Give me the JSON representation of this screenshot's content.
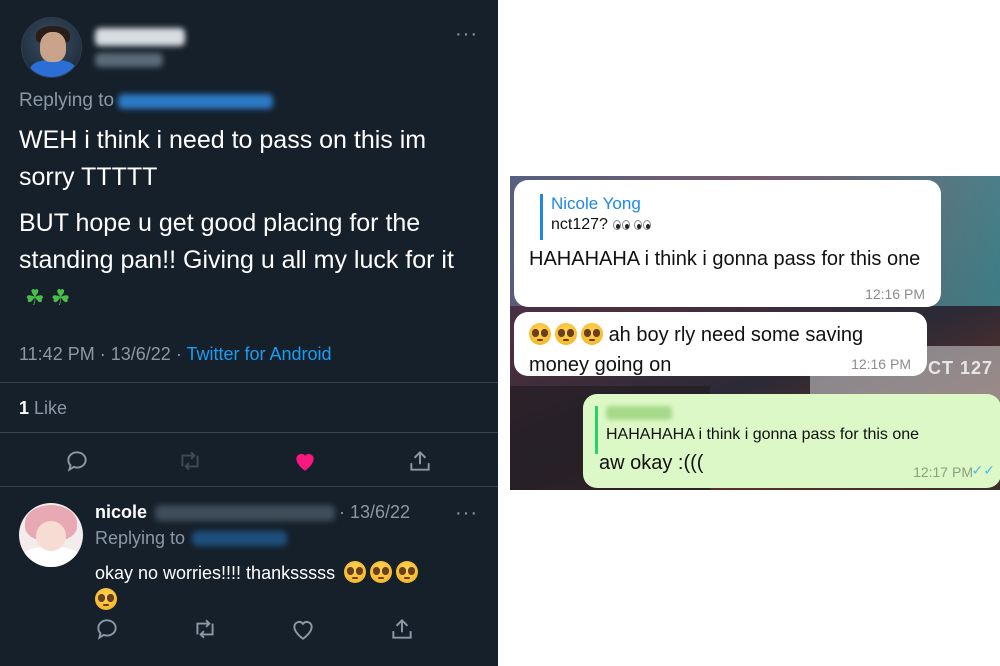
{
  "twitter": {
    "main_tweet": {
      "replying_to_label": "Replying to",
      "text_line1": "WEH i think i need to pass on this im sorry TTTTT",
      "text_line2": "BUT hope u get good placing for the standing pan!! Giving u all my luck for it",
      "text_line2_emoji": [
        "four-leaf-clover",
        "four-leaf-clover"
      ],
      "time": "11:42 PM",
      "date": "13/6/22",
      "source": "Twitter for Android",
      "likes_count": "1",
      "likes_label": "Like",
      "liked": true
    },
    "reply_tweet": {
      "author_name": "nicole",
      "date": "13/6/22",
      "replying_to_label": "Replying to",
      "text": "okay no worries!!!! thanksssss",
      "emoji": [
        "pleading-face",
        "pleading-face",
        "pleading-face",
        "pleading-face"
      ]
    },
    "colors": {
      "background": "#15202b",
      "text_secondary": "#8b98a5",
      "link": "#1d9bf0",
      "heart": "#f91880"
    }
  },
  "whatsapp": {
    "messages": [
      {
        "direction": "incoming",
        "quote_author": "Nicole Yong",
        "quote_text": "nct127?",
        "text": "HAHAHAHA i think i gonna pass for this one",
        "time": "12:16 PM"
      },
      {
        "direction": "incoming",
        "text": "ah boy rly need some saving money going on",
        "emoji": [
          "pleading-face",
          "pleading-face",
          "pleading-face"
        ],
        "time": "12:16 PM"
      },
      {
        "direction": "outgoing",
        "quote_text": "HAHAHAHA i think i gonna pass for this one",
        "text": "aw okay :(((",
        "time": "12:17 PM",
        "read_status": "double-check"
      }
    ],
    "background_text": "CT 127",
    "colors": {
      "incoming": "#ffffff",
      "outgoing": "#dcf8c6",
      "quote_name": "#1e88e5",
      "read_ticks": "#4fb6ec"
    }
  }
}
